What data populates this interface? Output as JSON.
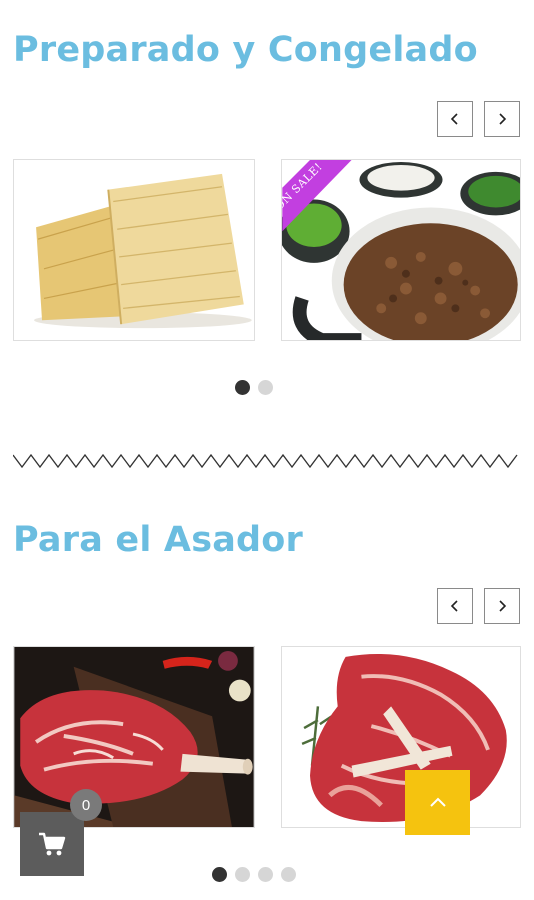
{
  "sections": [
    {
      "title": "Preparado y Congelado",
      "products": [
        {
          "image": "tamales"
        },
        {
          "image": "ground-meat-with-salsas",
          "badge": "ON SALE!"
        }
      ],
      "pagination": {
        "pages": 2,
        "active": 1
      }
    },
    {
      "title": "Para el Asador",
      "products": [
        {
          "image": "tomahawk-steak"
        },
        {
          "image": "t-bone-steak"
        }
      ],
      "pagination": {
        "pages": 4,
        "active": 1
      }
    }
  ],
  "icons": {
    "prev": "chevron-left-icon",
    "next": "chevron-right-icon",
    "cart": "shopping-cart-icon",
    "scroll_top": "chevron-up-icon"
  },
  "cart": {
    "count": "0"
  },
  "colors": {
    "title": "#6bbde0",
    "scroll_top": "#f5c30f",
    "cart_button": "#5c5c5c",
    "sale_ribbon": "#c23fe0",
    "dot_active": "#333333",
    "dot_inactive": "#d6d6d6"
  }
}
